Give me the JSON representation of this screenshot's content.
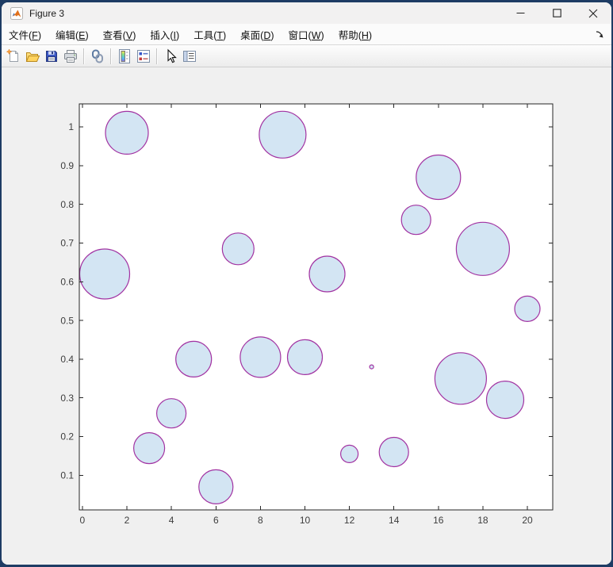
{
  "window": {
    "title": "Figure 3",
    "controls": [
      {
        "name": "minimize"
      },
      {
        "name": "maximize"
      },
      {
        "name": "close"
      }
    ]
  },
  "menu_bar": {
    "items": [
      {
        "name": "file",
        "label": "文件",
        "mnemonic": "F"
      },
      {
        "name": "edit",
        "label": "编辑",
        "mnemonic": "E"
      },
      {
        "name": "view",
        "label": "查看",
        "mnemonic": "V"
      },
      {
        "name": "insert",
        "label": "插入",
        "mnemonic": "I"
      },
      {
        "name": "tools",
        "label": "工具",
        "mnemonic": "T"
      },
      {
        "name": "desktop",
        "label": "桌面",
        "mnemonic": "D"
      },
      {
        "name": "window",
        "label": "窗口",
        "mnemonic": "W"
      },
      {
        "name": "help",
        "label": "帮助",
        "mnemonic": "H"
      }
    ],
    "dock_icon": "dock-arrow-icon"
  },
  "toolbar": {
    "groups": [
      [
        "new-document",
        "open-folder",
        "save",
        "print"
      ],
      [
        "link-plot"
      ],
      [
        "insert-colorbar",
        "insert-legend"
      ],
      [
        "edit-plot-arrow",
        "property-inspector"
      ]
    ]
  },
  "chart_data": {
    "type": "scatter",
    "subtype": "bubble",
    "x": [
      1,
      2,
      3,
      4,
      5,
      6,
      7,
      8,
      9,
      10,
      11,
      12,
      13,
      14,
      15,
      16,
      17,
      18,
      19,
      20
    ],
    "y": [
      0.62,
      0.985,
      0.17,
      0.26,
      0.4,
      0.07,
      0.685,
      0.405,
      0.98,
      0.405,
      0.62,
      0.155,
      0.38,
      0.16,
      0.76,
      0.87,
      0.35,
      0.685,
      0.295,
      0.53
    ],
    "radius_px": [
      31.5,
      27,
      19.5,
      18.5,
      22.5,
      21.5,
      20,
      25.5,
      29.5,
      22,
      22.5,
      11,
      2.5,
      18.5,
      18.5,
      28,
      32.5,
      33.5,
      23.5,
      16
    ],
    "xlim": [
      -0.14,
      21.14
    ],
    "ylim": [
      0.0104,
      1.0595
    ],
    "xticks": [
      0,
      2,
      4,
      6,
      8,
      10,
      12,
      14,
      16,
      18,
      20
    ],
    "xtick_labels": [
      "0",
      "2",
      "4",
      "6",
      "8",
      "10",
      "12",
      "14",
      "16",
      "18",
      "20"
    ],
    "yticks": [
      0.1,
      0.2,
      0.3,
      0.4,
      0.5,
      0.6,
      0.7,
      0.8,
      0.9,
      1
    ],
    "ytick_labels": [
      "0.1",
      "0.2",
      "0.3",
      "0.4",
      "0.5",
      "0.6",
      "0.7",
      "0.8",
      "0.9",
      "1"
    ],
    "title": "",
    "xlabel": "",
    "ylabel": "",
    "grid": false,
    "legend": null,
    "marker_fill": "#d3e5f3",
    "marker_edge": "#a233a2",
    "axis_color": "#262626",
    "tick_label_color": "#3d3d3d",
    "plot_bg": "#ffffff",
    "figure_bg": "#f0f0f0"
  }
}
